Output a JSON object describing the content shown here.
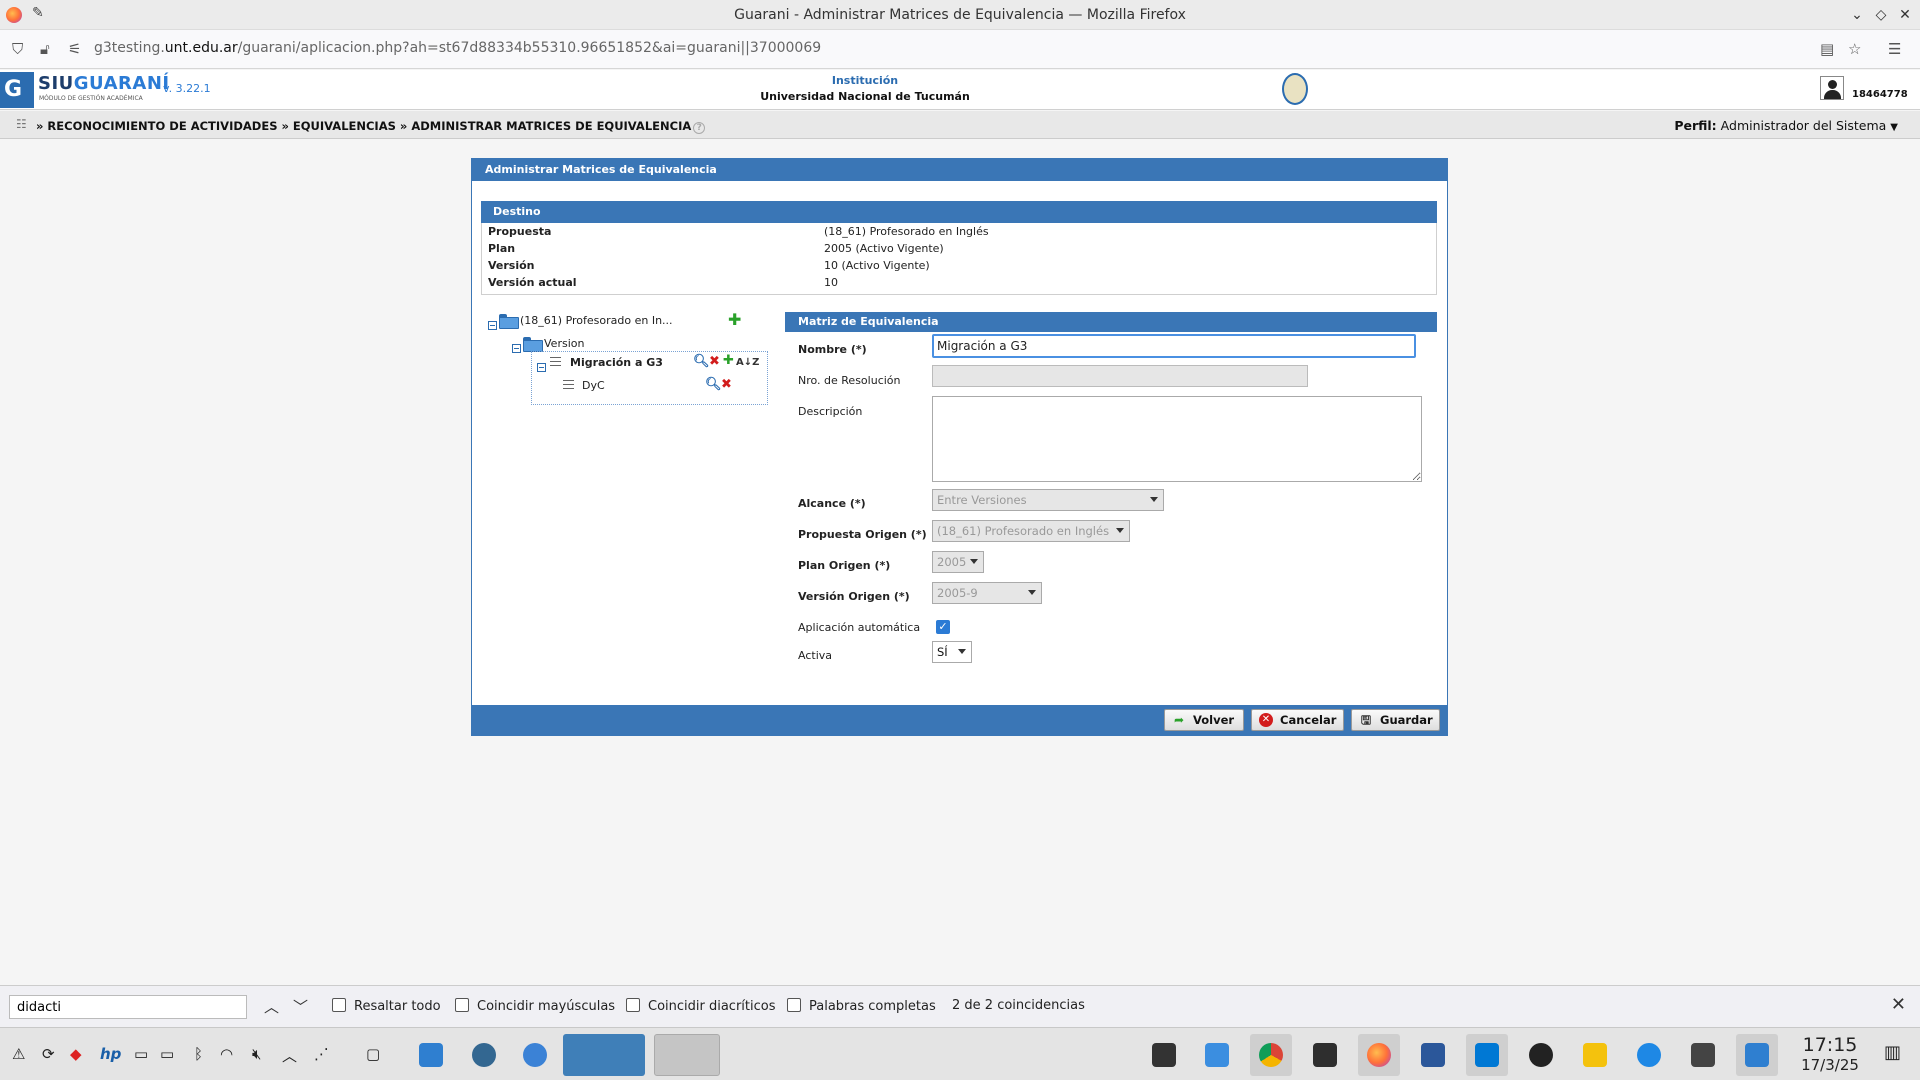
{
  "browser": {
    "window_title": "Guarani - Administrar Matrices de Equivalencia — Mozilla Firefox",
    "url_prefix": "g3testing.",
    "url_domain": "unt.edu.ar",
    "url_path": "/guarani/aplicacion.php?ah=st67d88334b55310.96651852&ai=guarani||37000069"
  },
  "header": {
    "logo_prefix": "SIU",
    "logo_name": "GUARANÍ",
    "logo_sub": "MÓDULO DE GESTIÓN ACADÉMICA",
    "logo_letter": "G",
    "version": "v. 3.22.1",
    "institucion_label": "Institución",
    "institucion_name": "Universidad Nacional de Tucumán",
    "user_id": "18464778"
  },
  "breadcrumb": {
    "text": "» RECONOCIMIENTO DE ACTIVIDADES » EQUIVALENCIAS » ADMINISTRAR MATRICES DE EQUIVALENCIA",
    "help": "?",
    "perfil_label": "Perfil:",
    "perfil_value": "Administrador del Sistema"
  },
  "panel": {
    "title": "Administrar Matrices de Equivalencia",
    "destino": {
      "title": "Destino",
      "rows": [
        {
          "label": "Propuesta",
          "value": "(18_61) Profesorado en Inglés"
        },
        {
          "label": "Plan",
          "value": "2005 (Activo Vigente)"
        },
        {
          "label": "Versión",
          "value": "10 (Activo Vigente)"
        },
        {
          "label": "Versión actual",
          "value": "10"
        }
      ]
    },
    "tree": {
      "root": "(18_61) Profesorado en In...",
      "version": "Version",
      "item_selected": "Migración a G3",
      "item_2": "DyC"
    },
    "matriz": {
      "title": "Matriz de Equivalencia",
      "nombre_label": "Nombre (*)",
      "nombre_value": "Migración a G3",
      "resolucion_label": "Nro. de Resolución",
      "resolucion_value": "",
      "descripcion_label": "Descripción",
      "descripcion_value": "",
      "alcance_label": "Alcance (*)",
      "alcance_value": "Entre Versiones",
      "propuesta_label": "Propuesta Origen (*)",
      "propuesta_value": "(18_61) Profesorado en Inglés",
      "plan_label": "Plan Origen (*)",
      "plan_value": "2005",
      "version_label": "Versión Origen (*)",
      "version_value": "2005-9",
      "aplicacion_label": "Aplicación automática",
      "aplicacion_checked": true,
      "activa_label": "Activa",
      "activa_value": "SÍ"
    },
    "buttons": {
      "volver": "Volver",
      "cancelar": "Cancelar",
      "guardar": "Guardar"
    }
  },
  "findbar": {
    "query": "didacti",
    "resaltar": "Resaltar todo",
    "mayusculas": "Coincidir mayúsculas",
    "diacriticos": "Coincidir diacríticos",
    "palabras": "Palabras completas",
    "count": "2 de 2 coincidencias"
  },
  "taskbar": {
    "time": "17:15",
    "date": "17/3/25"
  }
}
